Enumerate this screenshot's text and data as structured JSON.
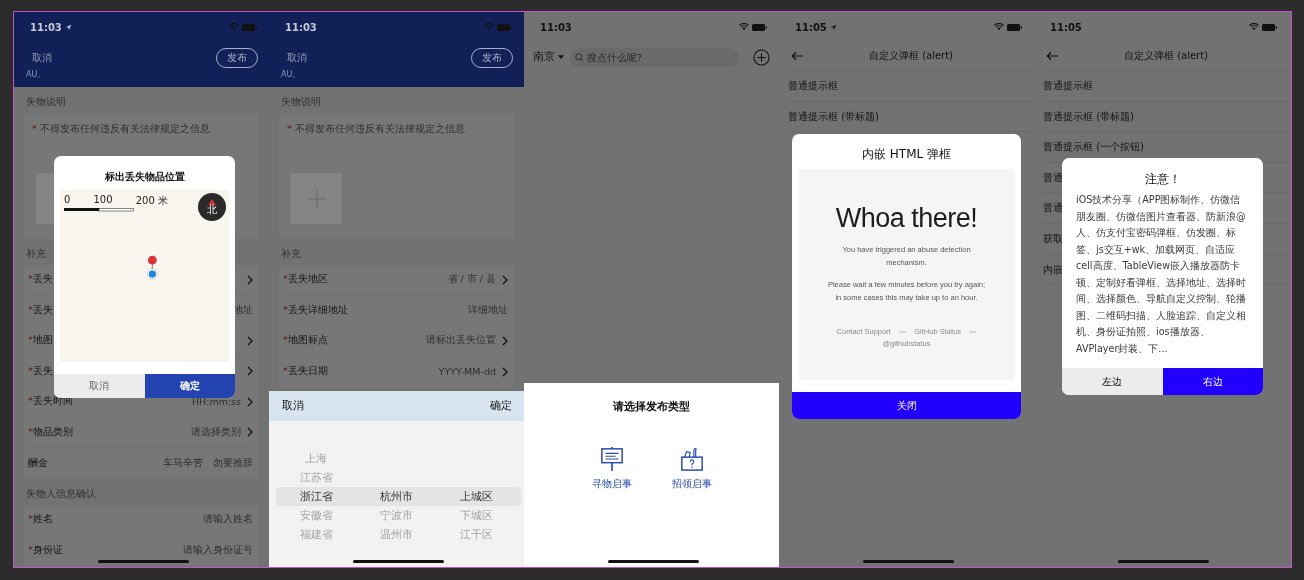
{
  "screens": [
    {
      "kind": "form",
      "status": {
        "time": "11:03",
        "location_arrow": true
      },
      "header": {
        "cancel": "取消",
        "publish": "发布",
        "note": "AU。"
      },
      "sections": [
        {
          "kind": "notice",
          "title": "失物说明",
          "mark": "*",
          "text": "不得发布任何违反有关法律规定之信息",
          "add_photo": true
        },
        {
          "kind": "rows",
          "title": "补充",
          "rows": [
            {
              "mark": "*",
              "label": "丢失",
              "chevron": true
            },
            {
              "mark": "*",
              "label": "丢失",
              "value": "地址",
              "chevron": false
            },
            {
              "mark": "*",
              "label": "地图",
              "chevron": true
            },
            {
              "mark": "*",
              "label": "丢失",
              "chevron": true
            },
            {
              "mark": "*",
              "label": "丢失时间",
              "value": "HH:mm:ss",
              "chevron": true
            },
            {
              "mark": "*",
              "label": "物品类别",
              "value": "请选择类别",
              "chevron": true
            },
            {
              "label": "酬金",
              "value": "车马辛苦　勿要推辞",
              "chevron": false
            }
          ]
        },
        {
          "kind": "rows",
          "title": "失物人信息确认",
          "rows": [
            {
              "mark": "*",
              "label": "姓名",
              "value": "请输入姓名",
              "chevron": false
            },
            {
              "mark": "*",
              "label": "身份证",
              "value": "请输入身份证号",
              "chevron": false
            }
          ]
        }
      ],
      "overlay": {
        "kind": "map_dialog",
        "title": "标出丢失物品位置",
        "scale": [
          "0",
          "100",
          "200 米"
        ],
        "compass": "北",
        "cancel": "取消",
        "confirm": "确定"
      }
    },
    {
      "kind": "form",
      "status": {
        "time": "11:03",
        "location_arrow": false
      },
      "header": {
        "cancel": "取消",
        "publish": "发布",
        "note": "AU。"
      },
      "sections": [
        {
          "kind": "notice",
          "title": "失物说明",
          "mark": "*",
          "text": "不得发布任何违反有关法律规定之信息",
          "add_photo": true
        },
        {
          "kind": "rows",
          "title": "补充",
          "rows": [
            {
              "mark": "*",
              "label": "丢失地区",
              "value": "省 / 市 / 县",
              "chevron": true
            },
            {
              "mark": "*",
              "label": "丢失详细地址",
              "value": "详细地址",
              "chevron": false
            },
            {
              "mark": "*",
              "label": "地图标点",
              "value": "请标出丢失位置",
              "chevron": true
            },
            {
              "mark": "*",
              "label": "丢失日期",
              "value": "YYYY-MM-dd",
              "chevron": true
            }
          ]
        }
      ],
      "overlay": {
        "kind": "region_picker",
        "cancel": "取消",
        "confirm": "确定",
        "columns": [
          {
            "items": [
              {
                "text": "上海",
                "selected": false
              },
              {
                "text": "江苏省",
                "selected": false
              },
              {
                "text": "浙江省",
                "selected": true
              },
              {
                "text": "安徽省",
                "selected": false
              },
              {
                "text": "福建省",
                "selected": false
              }
            ]
          },
          {
            "items": [
              {
                "text": "杭州市",
                "selected": true
              },
              {
                "text": "宁波市",
                "selected": false
              },
              {
                "text": "温州市",
                "selected": false
              }
            ]
          },
          {
            "items": [
              {
                "text": "上城区",
                "selected": true
              },
              {
                "text": "下城区",
                "selected": false
              },
              {
                "text": "江干区",
                "selected": false
              }
            ]
          }
        ]
      }
    },
    {
      "kind": "home",
      "status": {
        "time": "11:03",
        "location_arrow": false
      },
      "city": "南京",
      "search": {
        "placeholder": "搜点什么呢?"
      },
      "sheet": {
        "title": "请选择发布类型",
        "options": [
          {
            "kind": "lost",
            "label": "寻物启事"
          },
          {
            "kind": "found",
            "label": "招领启事"
          }
        ]
      }
    },
    {
      "kind": "alert_list",
      "status": {
        "time": "11:05",
        "location_arrow": true
      },
      "title": "自定义弹框 (alert)",
      "items": [
        "普通提示框",
        "普通提示框 (带标题)"
      ],
      "dialog": {
        "kind": "html",
        "title": "内嵌 HTML 弹框",
        "heading": "Whoa there!",
        "paragraphs": [
          "You have triggered an abuse detection mechanism.",
          "Please wait a few minutes before you try again;\nin some cases this may take up to an hour."
        ],
        "footer": [
          {
            "kind": "link",
            "text": "Contact Support"
          },
          {
            "kind": "separator",
            "text": "—"
          },
          {
            "kind": "link",
            "text": "GitHub Status"
          },
          {
            "kind": "separator",
            "text": "—"
          },
          {
            "kind": "link",
            "text": "@githubstatus"
          }
        ],
        "buttons": [
          {
            "label": "关闭",
            "primary": true
          }
        ]
      }
    },
    {
      "kind": "alert_list",
      "status": {
        "time": "11:05",
        "location_arrow": false
      },
      "title": "自定义弹框 (alert)",
      "items": [
        "普通提示框",
        "普通提示框 (带标题)",
        "普通提示框 (一个按钮)",
        "普通",
        "普通",
        "获取",
        "内嵌"
      ],
      "dialog": {
        "kind": "text",
        "title": "注意！",
        "body": "iOS技术分享（APP图标制作、仿微信朋友圈、仿微信图片查看器、防新浪@人、仿支付宝密码弹框、仿发圈、标签、js交互+wk、加载网页、自适应cell高度、TableView嵌入播放器防卡顿、定制好看弹框、选择地址、选择时间、选择颜色、导航自定义控制、轮播图、二维码扫描、人脸追踪、自定义相机、身份证拍照、ios播放器、AVPlayer封装、下...",
        "buttons": [
          {
            "label": "左边",
            "primary": false
          },
          {
            "label": "右边",
            "primary": true
          }
        ]
      }
    }
  ]
}
